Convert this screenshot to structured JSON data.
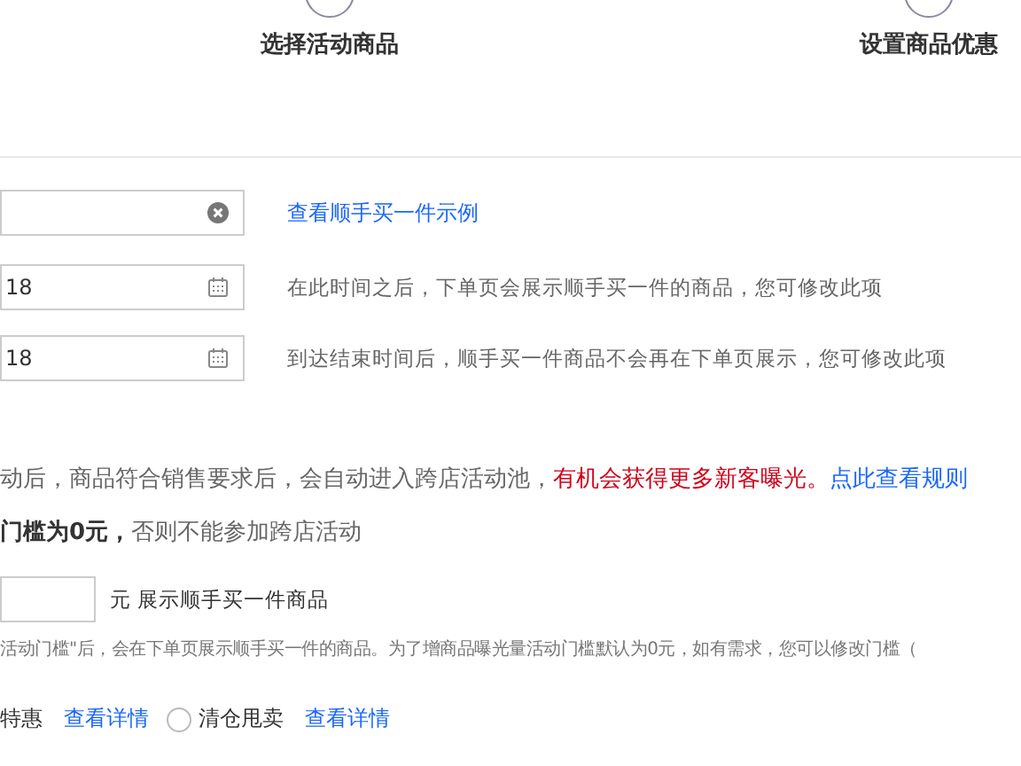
{
  "steps": [
    {
      "label": "选择活动商品"
    },
    {
      "label": "设置商品优惠"
    }
  ],
  "name_field": {
    "link": "查看顺手买一件示例"
  },
  "date_fields": [
    {
      "value": "18",
      "hint": "在此时间之后，下单页会展示顺手买一件的商品，您可修改此项"
    },
    {
      "value": "18",
      "hint": "到达结束时间后，顺手买一件商品不会再在下单页展示，您可修改此项"
    }
  ],
  "notice": {
    "text": "动后，商品符合销售要求后，会自动进入跨店活动池，",
    "highlight": "有机会获得更多新客曝光。",
    "link": "点此查看规则"
  },
  "requirement": "**门槛为0元，**否则不能参加跨店活动",
  "threshold": {
    "unit": "元 展示顺手买一件商品",
    "hint": "活动门槛\"后，会在下单页展示顺手买一件的商品。为了增商品曝光量活动门槛默认为0元，如有需求，您可以修改门槛（"
  },
  "types": [
    {
      "kind": "plain",
      "label": "特惠",
      "link": "查看详情"
    },
    {
      "kind": "radio",
      "label": "清仓甩卖",
      "link": "查看详情",
      "selected": false
    }
  ]
}
